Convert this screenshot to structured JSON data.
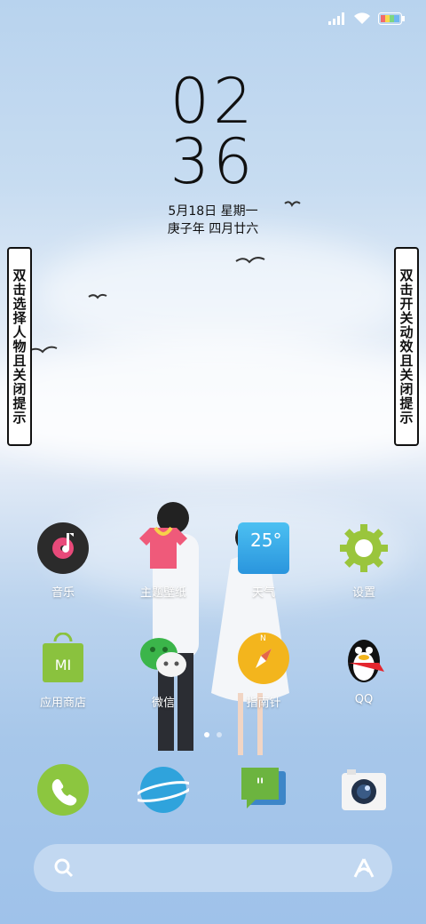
{
  "status": {
    "icons": [
      "signal-icon",
      "wifi-icon",
      "battery-icon"
    ]
  },
  "clock": {
    "hours": "02",
    "minutes": "36"
  },
  "date": {
    "line1": "5月18日 星期一",
    "line2": "庚子年 四月廿六"
  },
  "tips": {
    "left": "双击选择人物且关闭提示",
    "right": "双击开关动效且关闭提示"
  },
  "apps_row1": [
    {
      "label": "音乐",
      "icon": "music-icon"
    },
    {
      "label": "主题壁纸",
      "icon": "theme-icon"
    },
    {
      "label": "天气",
      "icon": "weather-icon",
      "temp": "25°"
    },
    {
      "label": "设置",
      "icon": "gear-icon"
    }
  ],
  "apps_row2": [
    {
      "label": "应用商店",
      "icon": "app-store-icon"
    },
    {
      "label": "微信",
      "icon": "wechat-icon"
    },
    {
      "label": "指南针",
      "icon": "compass-icon",
      "mark": "N"
    },
    {
      "label": "QQ",
      "icon": "qq-icon"
    }
  ],
  "dock": [
    {
      "icon": "phone-icon"
    },
    {
      "icon": "browser-icon"
    },
    {
      "icon": "messages-icon"
    },
    {
      "icon": "camera-icon"
    }
  ],
  "colors": {
    "music": "#2b2b2b",
    "weather": "#39a6e8",
    "gear": "#9ac53c",
    "store": "#8ac23e",
    "wechat": "#3bb54a",
    "compass": "#f3b51d",
    "phone": "#8cc63f",
    "browser": "#2fa3dc",
    "messages": "#6cb43f"
  }
}
